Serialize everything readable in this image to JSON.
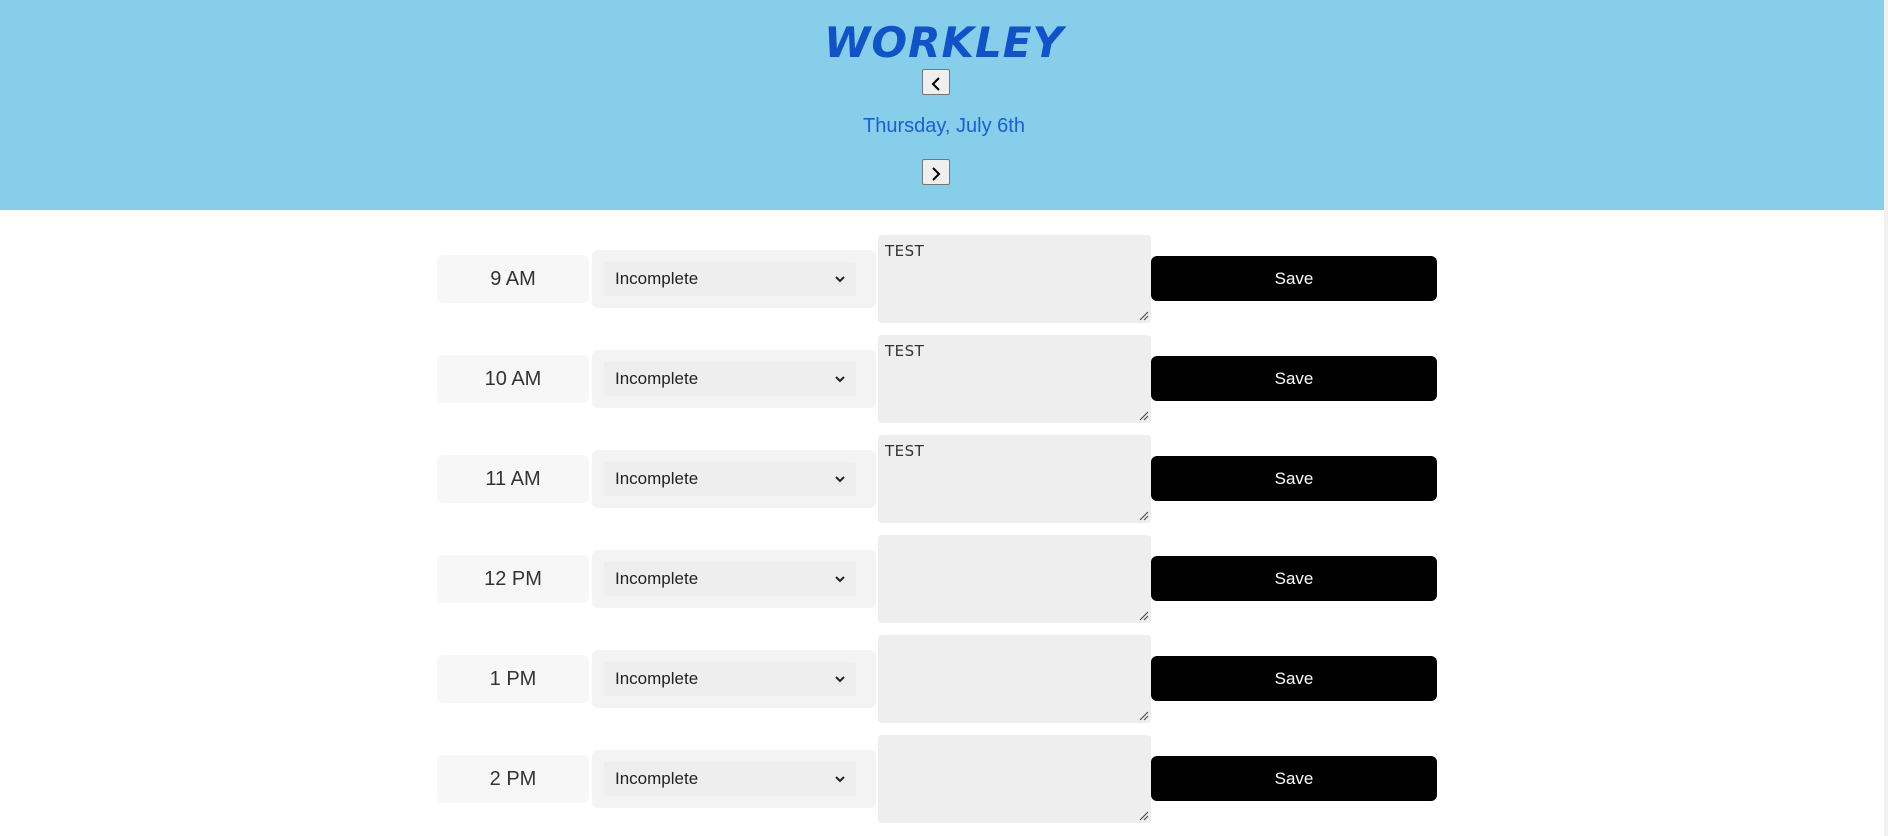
{
  "header": {
    "brand": "WORKLEY",
    "date": "Thursday, July 6th",
    "background": "#87ceeb",
    "accent": "#1152c9"
  },
  "hours": [
    {
      "label": "9 AM",
      "status": "Incomplete",
      "note": "TEST",
      "save_label": "Save"
    },
    {
      "label": "10 AM",
      "status": "Incomplete",
      "note": "TEST",
      "save_label": "Save"
    },
    {
      "label": "11 AM",
      "status": "Incomplete",
      "note": "TEST",
      "save_label": "Save"
    },
    {
      "label": "12 PM",
      "status": "Incomplete",
      "note": "",
      "save_label": "Save"
    },
    {
      "label": "1 PM",
      "status": "Incomplete",
      "note": "",
      "save_label": "Save"
    },
    {
      "label": "2 PM",
      "status": "Incomplete",
      "note": "",
      "save_label": "Save"
    }
  ],
  "icons": {
    "prev": "chevron-left-icon",
    "next": "chevron-right-icon",
    "dropdown": "chevron-down-icon",
    "resize": "resize-grip-icon"
  }
}
